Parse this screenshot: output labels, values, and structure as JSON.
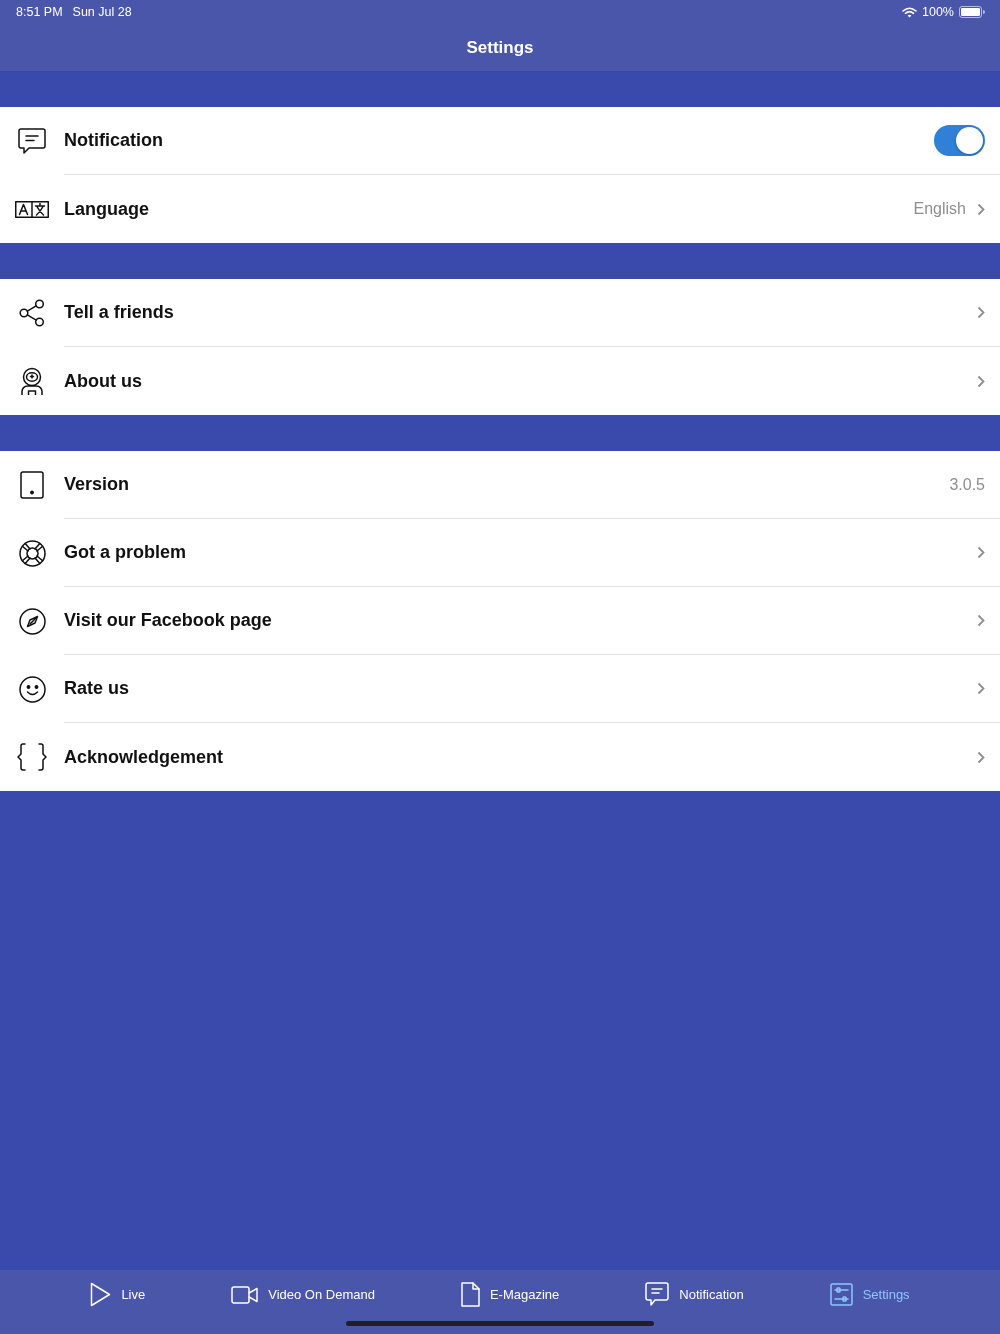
{
  "status_bar": {
    "time": "8:51 PM",
    "date": "Sun Jul 28",
    "battery": "100%"
  },
  "nav_bar": {
    "title": "Settings"
  },
  "sections": [
    {
      "rows": [
        {
          "kind": "toggle",
          "label": "Notification",
          "on": true
        },
        {
          "kind": "select",
          "label": "Language",
          "value": "English"
        }
      ]
    },
    {
      "rows": [
        {
          "kind": "link",
          "label": "Tell a friends"
        },
        {
          "kind": "link",
          "label": "About us"
        }
      ]
    },
    {
      "rows": [
        {
          "kind": "info",
          "label": "Version",
          "value": "3.0.5"
        },
        {
          "kind": "link",
          "label": "Got a problem"
        },
        {
          "kind": "link",
          "label": "Visit our Facebook page"
        },
        {
          "kind": "link",
          "label": "Rate us"
        },
        {
          "kind": "link",
          "label": "Acknowledgement"
        }
      ]
    }
  ],
  "tab_bar": {
    "tabs": [
      {
        "label": "Live",
        "selected": false
      },
      {
        "label": "Video On Demand",
        "selected": false
      },
      {
        "label": "E-Magazine",
        "selected": false
      },
      {
        "label": "Notification",
        "selected": false
      },
      {
        "label": "Settings",
        "selected": true
      }
    ]
  }
}
